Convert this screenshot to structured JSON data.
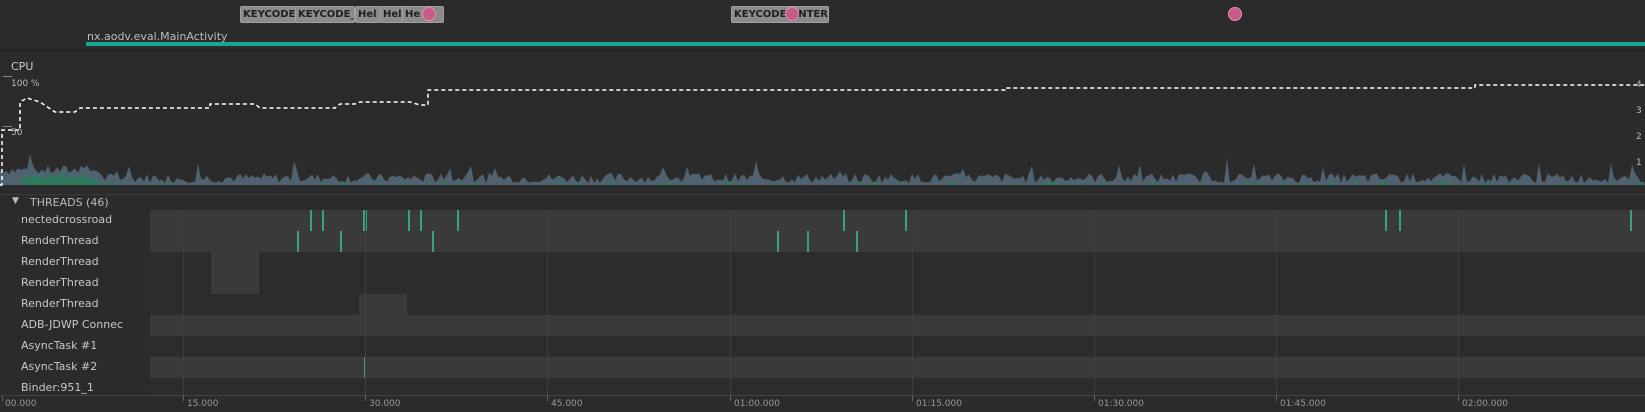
{
  "events": {
    "key_tags": [
      "KEYCODE",
      "KEYCODE_",
      "Hel",
      "Hel",
      "He",
      "KEYCODE_ENTER"
    ],
    "activity": "nx.aodv.eval.MainActivity"
  },
  "cpu": {
    "title": "CPU",
    "y_top_label": "100 %",
    "y_mid_label": "50",
    "right_labels": [
      "4",
      "3",
      "2",
      "1"
    ],
    "colors": {
      "usage": "#50626f",
      "app": "#2f7a5d",
      "threads_line": "#ffffff"
    }
  },
  "threads": {
    "toggle": "▼",
    "title": "THREADS (46)",
    "rows": [
      {
        "name": "nectedcrossroad"
      },
      {
        "name": "RenderThread"
      },
      {
        "name": "RenderThread"
      },
      {
        "name": "RenderThread"
      },
      {
        "name": "RenderThread"
      },
      {
        "name": "ADB-JDWP Connec"
      },
      {
        "name": "AsyncTask #1"
      },
      {
        "name": "AsyncTask #2"
      },
      {
        "name": "Binder:951_1"
      }
    ]
  },
  "timeline": {
    "labels": [
      "00.000",
      "15.000",
      "30.000",
      "45.000",
      "01:00.000",
      "01:15.000",
      "01:30.000",
      "01:45.000",
      "02:00.000"
    ]
  }
}
